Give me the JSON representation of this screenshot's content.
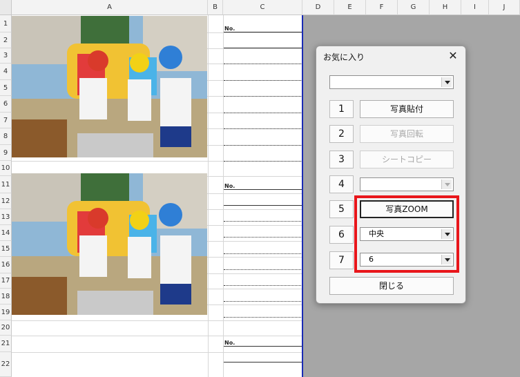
{
  "columns": [
    "A",
    "B",
    "C",
    "D",
    "E",
    "F",
    "G",
    "H",
    "I",
    "J"
  ],
  "rows": [
    "1",
    "2",
    "3",
    "4",
    "5",
    "6",
    "7",
    "8",
    "9",
    "10",
    "11",
    "12",
    "13",
    "14",
    "15",
    "16",
    "17",
    "18",
    "19",
    "20",
    "21",
    "22"
  ],
  "sheet": {
    "no_label": "No."
  },
  "dialog": {
    "title": "お気に入り",
    "close_glyph": "✕",
    "top_combo_value": "",
    "numbers": [
      "1",
      "2",
      "3",
      "4",
      "5",
      "6",
      "7"
    ],
    "buttons": {
      "paste": "写真貼付",
      "rotate": "写真回転",
      "sheet_copy": "シートコピー",
      "zoom": "写真ZOOM"
    },
    "combo4_value": "",
    "combo6_value": "中央",
    "combo7_value": "6",
    "close_label": "閉じる"
  },
  "colors": {
    "highlight": "#e8161b",
    "sheet_edge": "#1a2bb5"
  }
}
